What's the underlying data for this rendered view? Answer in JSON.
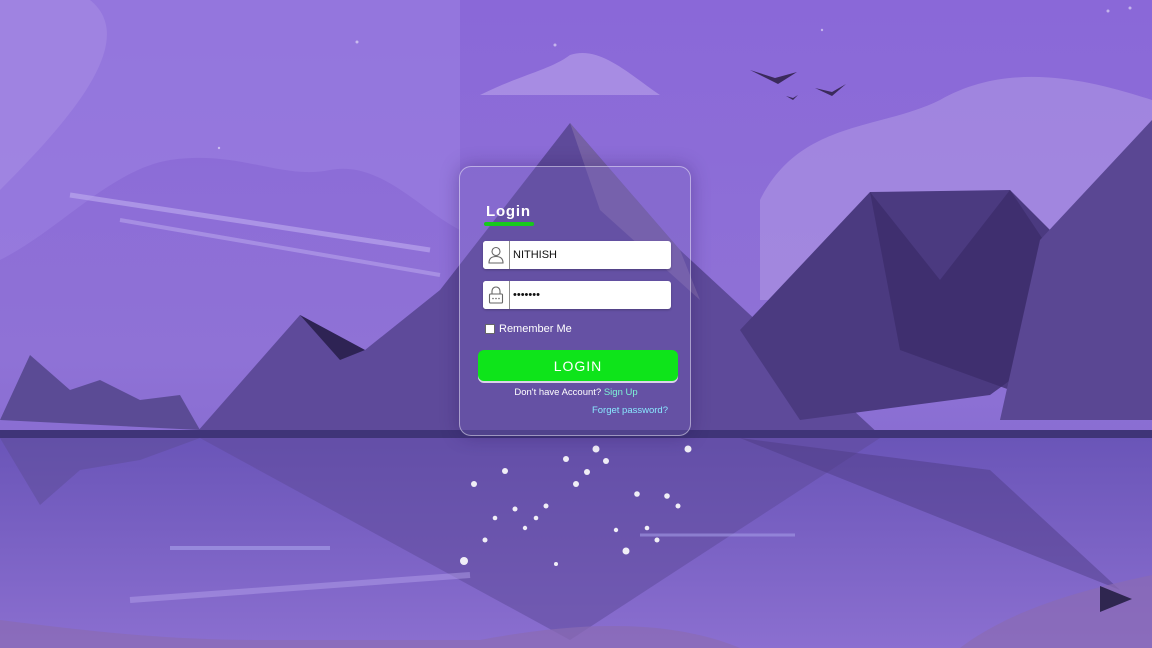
{
  "login": {
    "title": "Login",
    "username_value": "NITHISH",
    "password_masked": "•••••••",
    "remember_label": "Remember Me",
    "button_label": "LOGIN",
    "no_account_text": "Don't have Account?",
    "signup_link": "Sign Up",
    "forgot_link": "Forget password?"
  },
  "icons": [
    "user-icon",
    "lock-icon",
    "play-icon"
  ],
  "colors": {
    "primary_button": "#0ee41a",
    "underline": "#17c91c",
    "link": "#7ef5d6",
    "sky_top": "#8a68d8",
    "sky_bottom": "#6f55c0"
  }
}
